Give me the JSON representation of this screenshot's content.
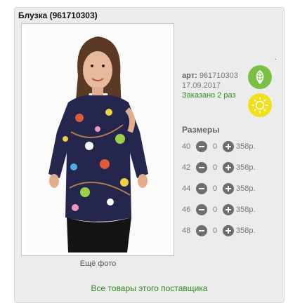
{
  "product": {
    "title": "Блузка (961710303)",
    "more_photo": "Ещё фото",
    "dot": ".",
    "article_label": "арт:",
    "article_value": "961710303",
    "date": "17.09.2017",
    "ordered": "Заказано 2 раз",
    "sizes_title": "Размеры",
    "sizes": [
      {
        "size": "40",
        "qty": "0",
        "price": "358р."
      },
      {
        "size": "42",
        "qty": "0",
        "price": "358р."
      },
      {
        "size": "44",
        "qty": "0",
        "price": "358р."
      },
      {
        "size": "46",
        "qty": "0",
        "price": "358р."
      },
      {
        "size": "48",
        "qty": "0",
        "price": "358р."
      }
    ],
    "supplier_link": "Все товары этого поставщика"
  },
  "icons": {
    "eco_badge": "leaf-icon",
    "summer_badge": "sun-icon",
    "decrease": "minus-icon",
    "increase": "plus-icon"
  },
  "colors": {
    "accent_green": "#2e8b1e",
    "leaf_badge": "#7cc043",
    "sun_badge": "#f3df1b",
    "button_gray": "#6e6e6e"
  }
}
